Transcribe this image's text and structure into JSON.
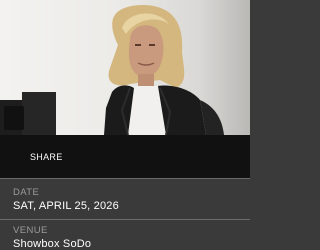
{
  "share": {
    "label": "SHARE"
  },
  "details": {
    "date_label": "DATE",
    "date_value": "SAT, APRIL 25, 2026",
    "venue_label": "VENUE",
    "venue_value": "Showbox SoDo"
  }
}
